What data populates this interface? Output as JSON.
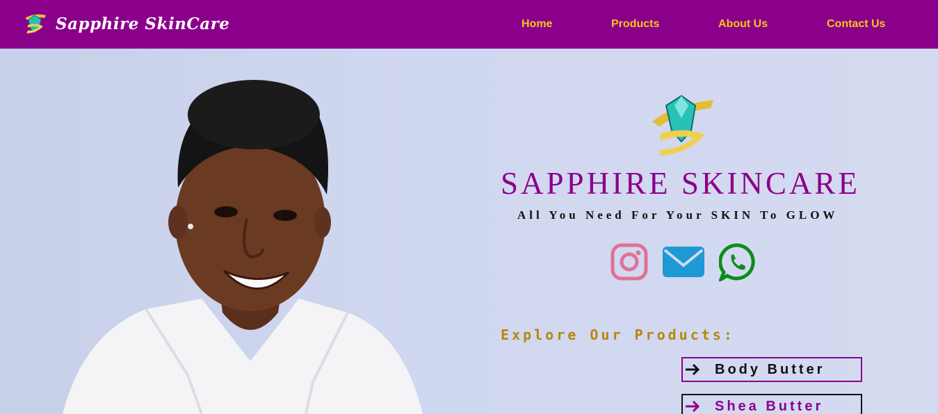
{
  "navbar": {
    "brand_name": "Sapphire SkinCare",
    "brand_logo_icon": "sapphire-gem-ribbon-icon",
    "links": [
      {
        "label": "Home"
      },
      {
        "label": "Products"
      },
      {
        "label": "About Us"
      },
      {
        "label": "Contact Us"
      }
    ]
  },
  "hero": {
    "logo_icon": "sapphire-gem-ribbon-icon",
    "title": "SAPPHIRE SKINCARE",
    "tagline": "All You Need For Your SKIN To GLOW",
    "social": [
      {
        "icon": "instagram-icon"
      },
      {
        "icon": "mail-icon"
      },
      {
        "icon": "whatsapp-icon"
      }
    ],
    "explore_label": "Explore Our Products:",
    "product_buttons": [
      {
        "label": "Body Butter",
        "icon": "arrow-right-icon"
      },
      {
        "label": "Shea Butter",
        "icon": "arrow-right-icon"
      }
    ]
  },
  "colors": {
    "navbar_bg": "#8b008b",
    "nav_link": "#f5c518",
    "title": "#8b008b",
    "explore": "#b8860b",
    "hero_bg": "#cfd6ee"
  }
}
